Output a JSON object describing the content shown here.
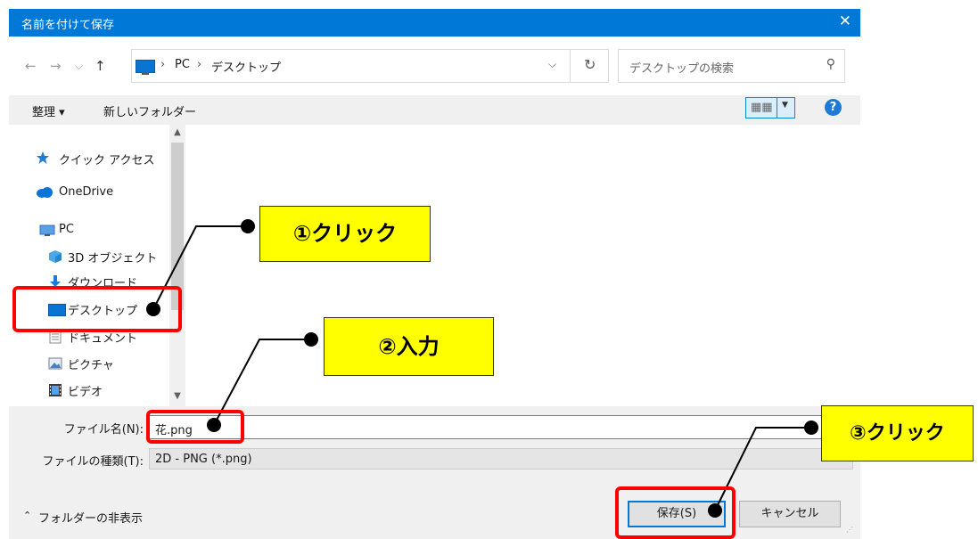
{
  "dialog": {
    "title": "名前を付けて保存",
    "close_glyph": "✕"
  },
  "address": {
    "back_glyph": "←",
    "forward_glyph": "→",
    "recent_glyph": "⌵",
    "up_glyph": "↑",
    "crumbs": [
      "PC",
      "デスクトップ"
    ],
    "separator": "›",
    "dropdown_glyph": "⌵",
    "refresh_glyph": "↻"
  },
  "search": {
    "placeholder": "デスクトップの検索",
    "icon_glyph": "⚲"
  },
  "toolbar": {
    "organize": "整理 ▾",
    "new_folder": "新しいフォルダー",
    "help": "?"
  },
  "nav_pane": {
    "items": [
      {
        "label": "クイック アクセス",
        "icon": "star-icon"
      },
      {
        "label": "OneDrive",
        "icon": "cloud-icon"
      },
      {
        "label": "PC",
        "icon": "computer-icon"
      },
      {
        "label": "3D オブジェクト",
        "icon": "cube-icon"
      },
      {
        "label": "ダウンロード",
        "icon": "download-icon"
      },
      {
        "label": "デスクトップ",
        "icon": "desktop-icon"
      },
      {
        "label": "ドキュメント",
        "icon": "document-icon"
      },
      {
        "label": "ピクチャ",
        "icon": "picture-icon"
      },
      {
        "label": "ビデオ",
        "icon": "video-icon"
      }
    ]
  },
  "form": {
    "filename_label": "ファイル名(N):",
    "filename_value": "花.png",
    "filetype_label": "ファイルの種類(T):",
    "filetype_value": "2D - PNG (*.png)"
  },
  "footer": {
    "hide_folders": "フォルダーの非表示",
    "save": "保存(S)",
    "cancel": "キャンセル"
  },
  "annotations": {
    "step1": "①クリック",
    "step2": "②入力",
    "step3": "③クリック",
    "callout_color": "#ffff00",
    "highlight_color": "#ff0000"
  },
  "colors": {
    "titlebar": "#0078d7",
    "accent": "#0a74d4"
  }
}
